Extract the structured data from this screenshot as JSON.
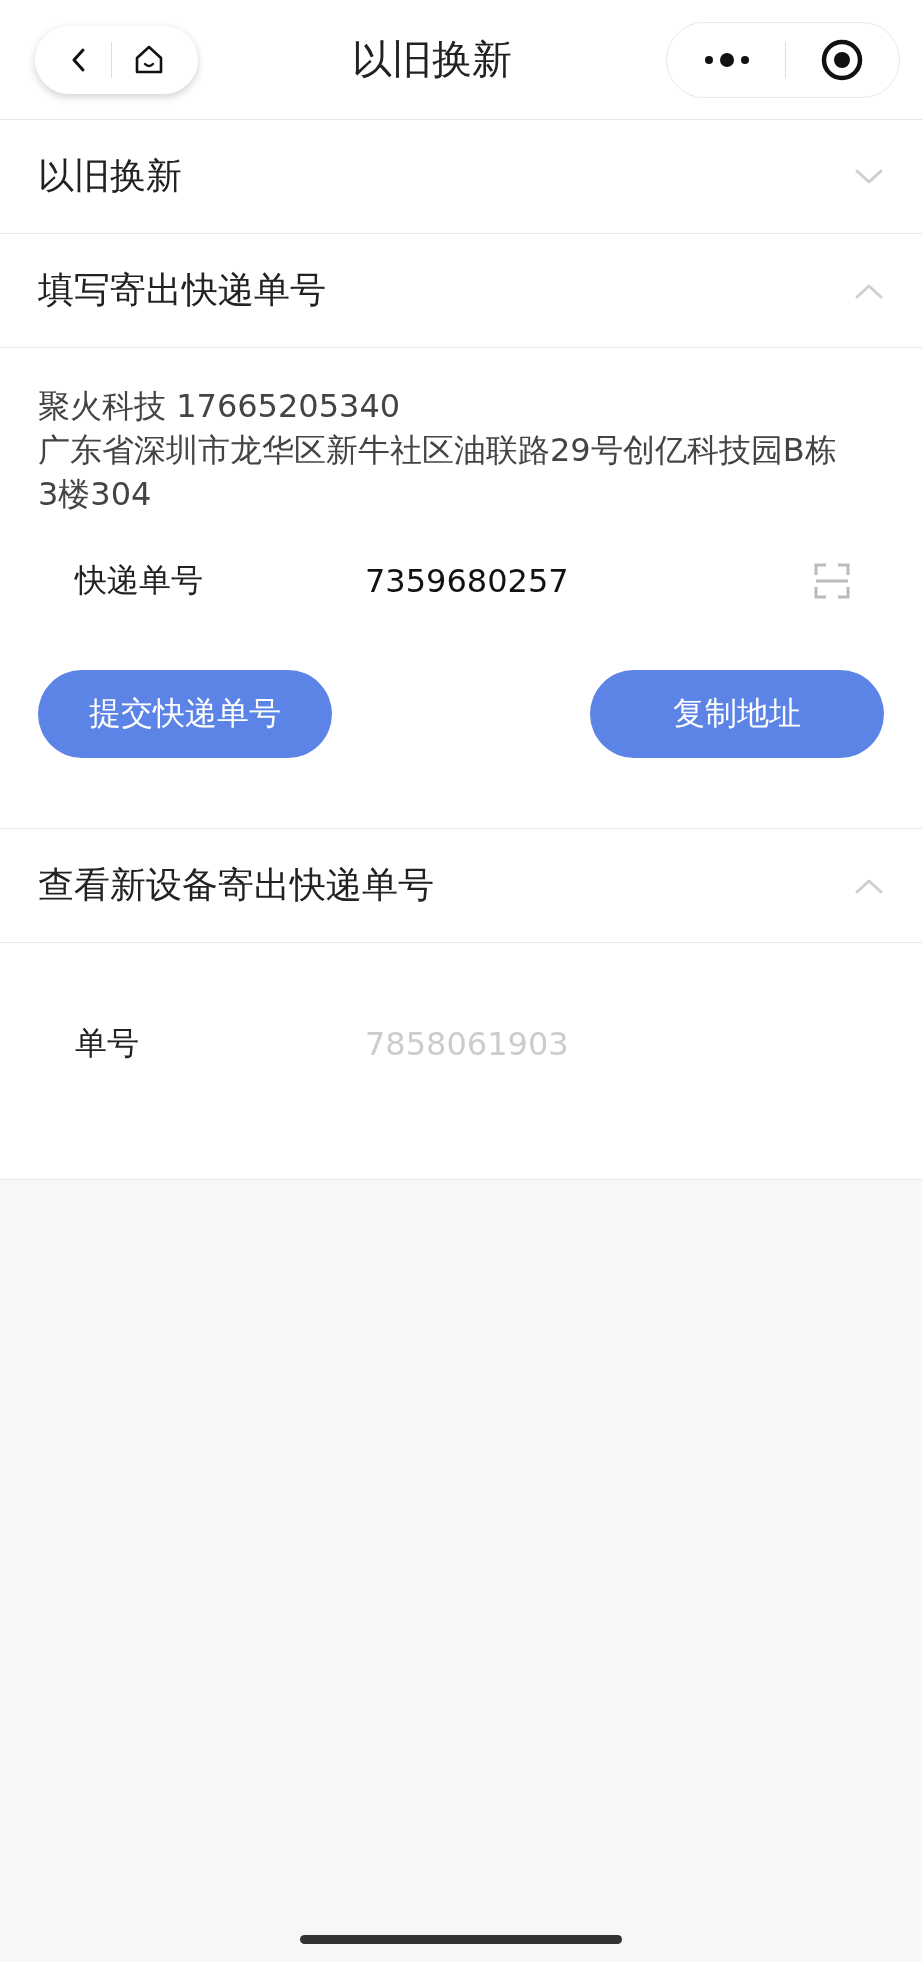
{
  "nav": {
    "title": "以旧换新"
  },
  "sections": [
    {
      "title": "以旧换新",
      "expanded": false
    },
    {
      "title": "填写寄出快递单号",
      "expanded": true,
      "contact": "聚火科技 17665205340",
      "address": "广东省深圳市龙华区新牛社区油联路29号创亿科技园B栋3楼304",
      "fields": [
        {
          "label": "快递单号",
          "value": "7359680257",
          "disabled": false,
          "scan": true
        }
      ],
      "buttons": [
        "提交快递单号",
        "复制地址"
      ]
    },
    {
      "title": "查看新设备寄出快递单号",
      "expanded": true,
      "fields": [
        {
          "label": "单号",
          "value": "7858061903",
          "disabled": true,
          "scan": false
        }
      ]
    }
  ]
}
